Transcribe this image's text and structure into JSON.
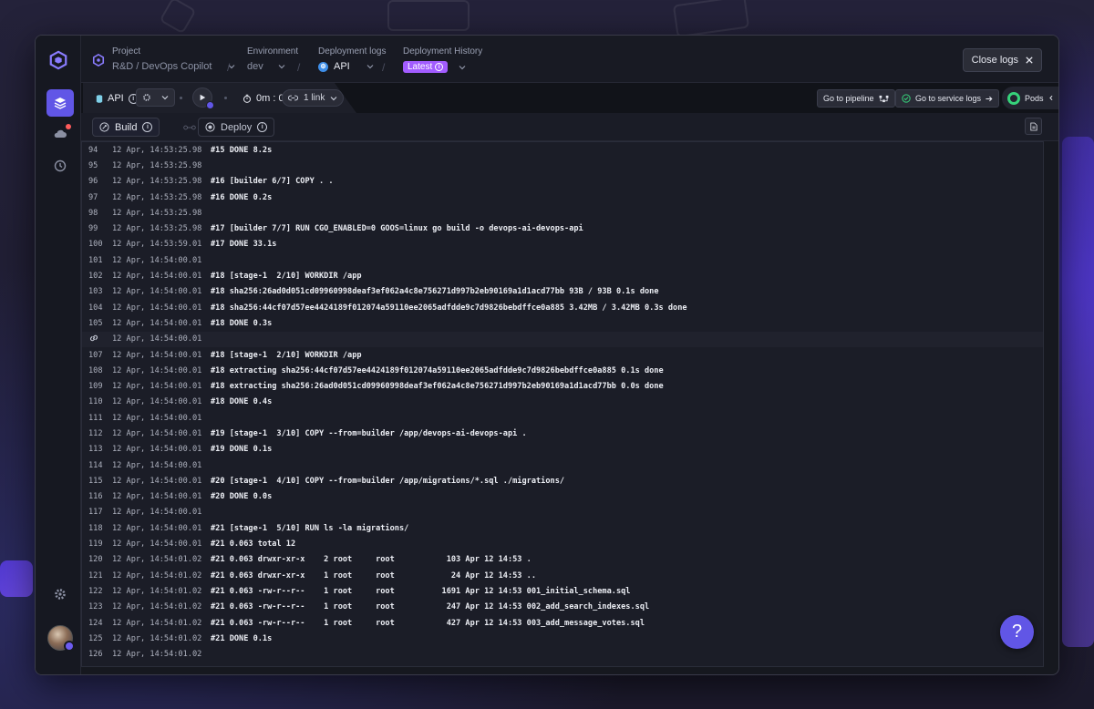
{
  "header": {
    "project_label": "Project",
    "project_value": "R&D / DevOps Copilot",
    "environment_label": "Environment",
    "environment_value": "dev",
    "deploy_logs_label": "Deployment logs",
    "deploy_logs_value": "API",
    "deploy_history_label": "Deployment History",
    "deploy_history_value": "Latest",
    "close_logs": "Close logs",
    "separator": "/"
  },
  "toolbar": {
    "service_name": "API",
    "timer": "0m : 0s",
    "links": "1 link",
    "go_pipeline": "Go to pipeline",
    "go_service_logs": "Go to service logs",
    "pods": "Pods"
  },
  "subtabs": {
    "build": "Build",
    "deploy": "Deploy"
  },
  "colors": {
    "accent": "#6156e6",
    "latest_badge": "#a25cff",
    "pods_ok": "#36d27a"
  },
  "logs": [
    {
      "ln": "94",
      "ts": "12 Apr, 14:53:25.98",
      "msg": "#15 DONE 8.2s"
    },
    {
      "ln": "95",
      "ts": "12 Apr, 14:53:25.98",
      "msg": ""
    },
    {
      "ln": "96",
      "ts": "12 Apr, 14:53:25.98",
      "msg": "#16 [builder 6/7] COPY . ."
    },
    {
      "ln": "97",
      "ts": "12 Apr, 14:53:25.98",
      "msg": "#16 DONE 0.2s"
    },
    {
      "ln": "98",
      "ts": "12 Apr, 14:53:25.98",
      "msg": ""
    },
    {
      "ln": "99",
      "ts": "12 Apr, 14:53:25.98",
      "msg": "#17 [builder 7/7] RUN CGO_ENABLED=0 GOOS=linux go build -o devops-ai-devops-api"
    },
    {
      "ln": "100",
      "ts": "12 Apr, 14:53:59.01",
      "msg": "#17 DONE 33.1s"
    },
    {
      "ln": "101",
      "ts": "12 Apr, 14:54:00.01",
      "msg": ""
    },
    {
      "ln": "102",
      "ts": "12 Apr, 14:54:00.01",
      "msg": "#18 [stage-1  2/10] WORKDIR /app"
    },
    {
      "ln": "103",
      "ts": "12 Apr, 14:54:00.01",
      "msg": "#18 sha256:26ad0d051cd09960998deaf3ef062a4c8e756271d997b2eb90169a1d1acd77bb 93B / 93B 0.1s done"
    },
    {
      "ln": "104",
      "ts": "12 Apr, 14:54:00.01",
      "msg": "#18 sha256:44cf07d57ee4424189f012074a59110ee2065adfdde9c7d9826bebdffce0a885 3.42MB / 3.42MB 0.3s done"
    },
    {
      "ln": "105",
      "ts": "12 Apr, 14:54:00.01",
      "msg": "#18 DONE 0.3s"
    },
    {
      "ln": "",
      "ts": "12 Apr, 14:54:00.01",
      "msg": "",
      "link": true
    },
    {
      "ln": "107",
      "ts": "12 Apr, 14:54:00.01",
      "msg": "#18 [stage-1  2/10] WORKDIR /app"
    },
    {
      "ln": "108",
      "ts": "12 Apr, 14:54:00.01",
      "msg": "#18 extracting sha256:44cf07d57ee4424189f012074a59110ee2065adfdde9c7d9826bebdffce0a885 0.1s done"
    },
    {
      "ln": "109",
      "ts": "12 Apr, 14:54:00.01",
      "msg": "#18 extracting sha256:26ad0d051cd09960998deaf3ef062a4c8e756271d997b2eb90169a1d1acd77bb 0.0s done"
    },
    {
      "ln": "110",
      "ts": "12 Apr, 14:54:00.01",
      "msg": "#18 DONE 0.4s"
    },
    {
      "ln": "111",
      "ts": "12 Apr, 14:54:00.01",
      "msg": ""
    },
    {
      "ln": "112",
      "ts": "12 Apr, 14:54:00.01",
      "msg": "#19 [stage-1  3/10] COPY --from=builder /app/devops-ai-devops-api ."
    },
    {
      "ln": "113",
      "ts": "12 Apr, 14:54:00.01",
      "msg": "#19 DONE 0.1s"
    },
    {
      "ln": "114",
      "ts": "12 Apr, 14:54:00.01",
      "msg": ""
    },
    {
      "ln": "115",
      "ts": "12 Apr, 14:54:00.01",
      "msg": "#20 [stage-1  4/10] COPY --from=builder /app/migrations/*.sql ./migrations/"
    },
    {
      "ln": "116",
      "ts": "12 Apr, 14:54:00.01",
      "msg": "#20 DONE 0.0s"
    },
    {
      "ln": "117",
      "ts": "12 Apr, 14:54:00.01",
      "msg": ""
    },
    {
      "ln": "118",
      "ts": "12 Apr, 14:54:00.01",
      "msg": "#21 [stage-1  5/10] RUN ls -la migrations/"
    },
    {
      "ln": "119",
      "ts": "12 Apr, 14:54:00.01",
      "msg": "#21 0.063 total 12"
    },
    {
      "ln": "120",
      "ts": "12 Apr, 14:54:01.02",
      "msg": "#21 0.063 drwxr-xr-x    2 root     root           103 Apr 12 14:53 ."
    },
    {
      "ln": "121",
      "ts": "12 Apr, 14:54:01.02",
      "msg": "#21 0.063 drwxr-xr-x    1 root     root            24 Apr 12 14:53 .."
    },
    {
      "ln": "122",
      "ts": "12 Apr, 14:54:01.02",
      "msg": "#21 0.063 -rw-r--r--    1 root     root          1691 Apr 12 14:53 001_initial_schema.sql"
    },
    {
      "ln": "123",
      "ts": "12 Apr, 14:54:01.02",
      "msg": "#21 0.063 -rw-r--r--    1 root     root           247 Apr 12 14:53 002_add_search_indexes.sql"
    },
    {
      "ln": "124",
      "ts": "12 Apr, 14:54:01.02",
      "msg": "#21 0.063 -rw-r--r--    1 root     root           427 Apr 12 14:53 003_add_message_votes.sql"
    },
    {
      "ln": "125",
      "ts": "12 Apr, 14:54:01.02",
      "msg": "#21 DONE 0.1s"
    },
    {
      "ln": "126",
      "ts": "12 Apr, 14:54:01.02",
      "msg": ""
    }
  ],
  "help_label": "?"
}
